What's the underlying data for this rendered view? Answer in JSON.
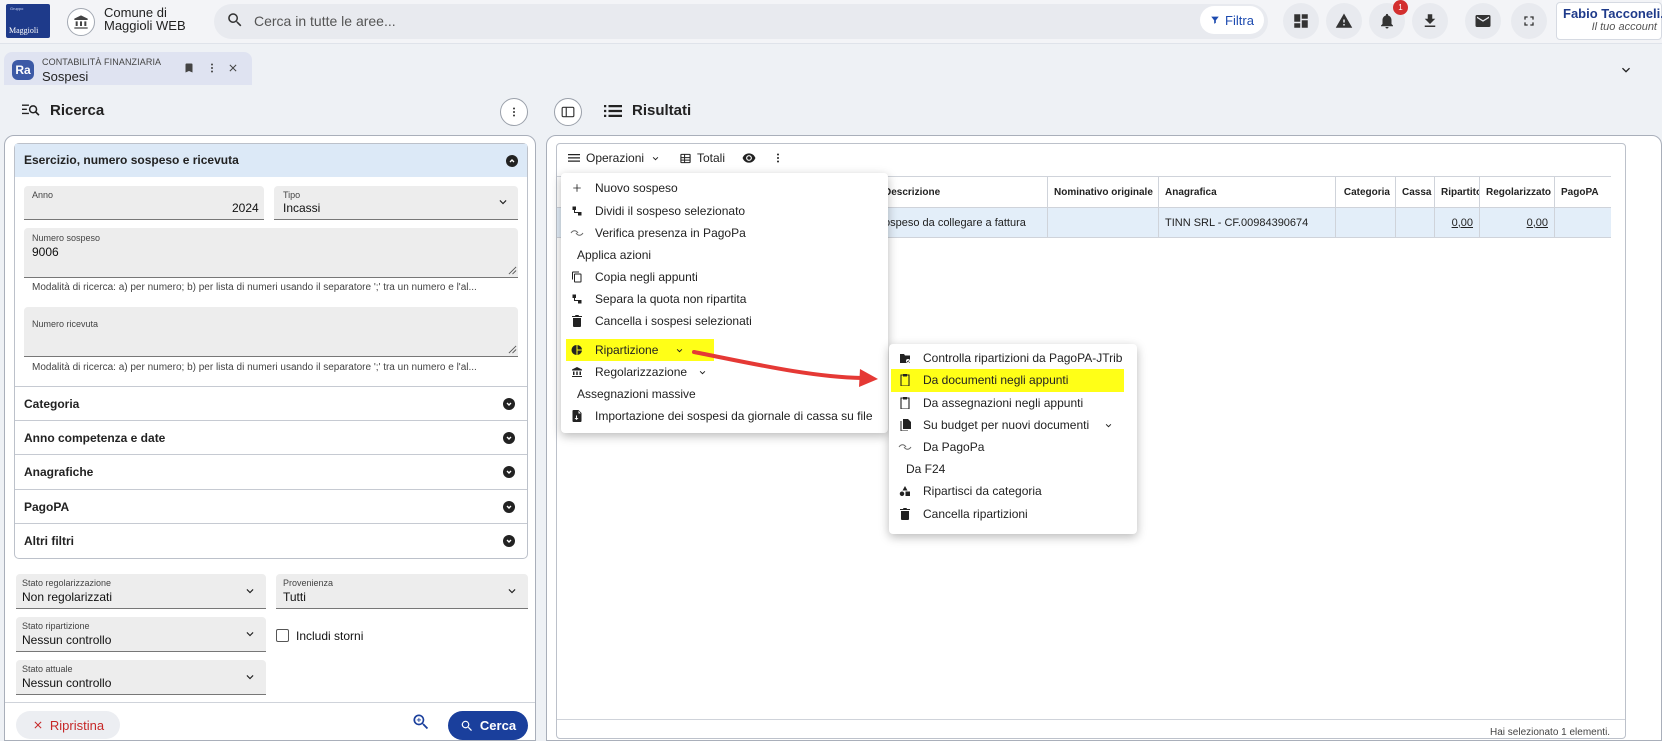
{
  "header": {
    "logo_text": "Maggioli",
    "logo_small": "Gruppo",
    "org_line1": "Comune di",
    "org_line2": "Maggioli WEB",
    "search_placeholder": "Cerca in tutte le aree...",
    "filter_label": "Filtra",
    "notification_count": "1",
    "user_name": "Fabio Tacconeli...",
    "user_subtitle": "Il tuo account"
  },
  "tab": {
    "badge": "Ra",
    "module": "CONTABILITÀ FINANZIARIA",
    "title": "Sospesi"
  },
  "search_panel": {
    "title": "Ricerca",
    "section_title": "Esercizio, numero sospeso e ricevuta",
    "anno_label": "Anno",
    "anno_value": "2024",
    "tipo_label": "Tipo",
    "tipo_value": "Incassi",
    "numero_sospeso_label": "Numero sospeso",
    "numero_sospeso_value": "9006",
    "numero_sospeso_hint": "Modalità di ricerca: a) per numero; b) per lista di numeri usando il separatore ';' tra un numero e l'al...",
    "numero_ricevuta_label": "Numero ricevuta",
    "numero_ricevuta_value": "",
    "numero_ricevuta_hint": "Modalità di ricerca: a) per numero; b) per lista di numeri usando il separatore ';' tra un numero e l'al...",
    "sections": [
      "Categoria",
      "Anno competenza e date",
      "Anagrafiche",
      "PagoPA",
      "Altri filtri"
    ],
    "stato_regolarizzazione_label": "Stato regolarizzazione",
    "stato_regolarizzazione_value": "Non regolarizzati",
    "provenienza_label": "Provenienza",
    "provenienza_value": "Tutti",
    "stato_ripartizione_label": "Stato ripartizione",
    "stato_ripartizione_value": "Nessun controllo",
    "includi_storni_label": "Includi storni",
    "stato_attuale_label": "Stato attuale",
    "stato_attuale_value": "Nessun controllo",
    "ripristina_label": "Ripristina",
    "cerca_label": "Cerca"
  },
  "results": {
    "title": "Risultati",
    "operazioni_label": "Operazioni",
    "totali_label": "Totali",
    "columns": [
      "Descrizione",
      "Nominativo originale",
      "Anagrafica",
      "Categoria",
      "Cassa",
      "Ripartito",
      "Regolarizzato",
      "PagoPA"
    ],
    "row": {
      "descrizione": "ospeso da collegare a fattura",
      "nominativo": "",
      "anagrafica": "TINN SRL - CF.00984390674",
      "categoria": "",
      "cassa": "",
      "ripartito": "0,00",
      "regolarizzato": "0,00",
      "pagopa": ""
    },
    "status": "Hai selezionato 1 elementi."
  },
  "ops_menu": {
    "items": [
      "Nuovo sospeso",
      "Dividi il sospeso selezionato",
      "Verifica presenza in PagoPa",
      "Applica azioni",
      "Copia negli appunti",
      "Separa la quota non ripartita",
      "Cancella i sospesi selezionati",
      "Ripartizione",
      "Regolarizzazione",
      "Assegnazioni massive",
      "Importazione dei sospesi da giornale di cassa su file"
    ]
  },
  "sub_menu": {
    "items": [
      "Controlla ripartizioni da PagoPA-JTrib",
      "Da documenti negli appunti",
      "Da assegnazioni negli appunti",
      "Su budget per nuovi documenti",
      "Da PagoPa",
      "Da F24",
      "Ripartisci da categoria",
      "Cancella ripartizioni"
    ]
  },
  "colors": {
    "accent": "#1a3f9c",
    "highlight": "#ffff17",
    "arrow": "#e53935",
    "row_selected": "#e3eef9"
  }
}
